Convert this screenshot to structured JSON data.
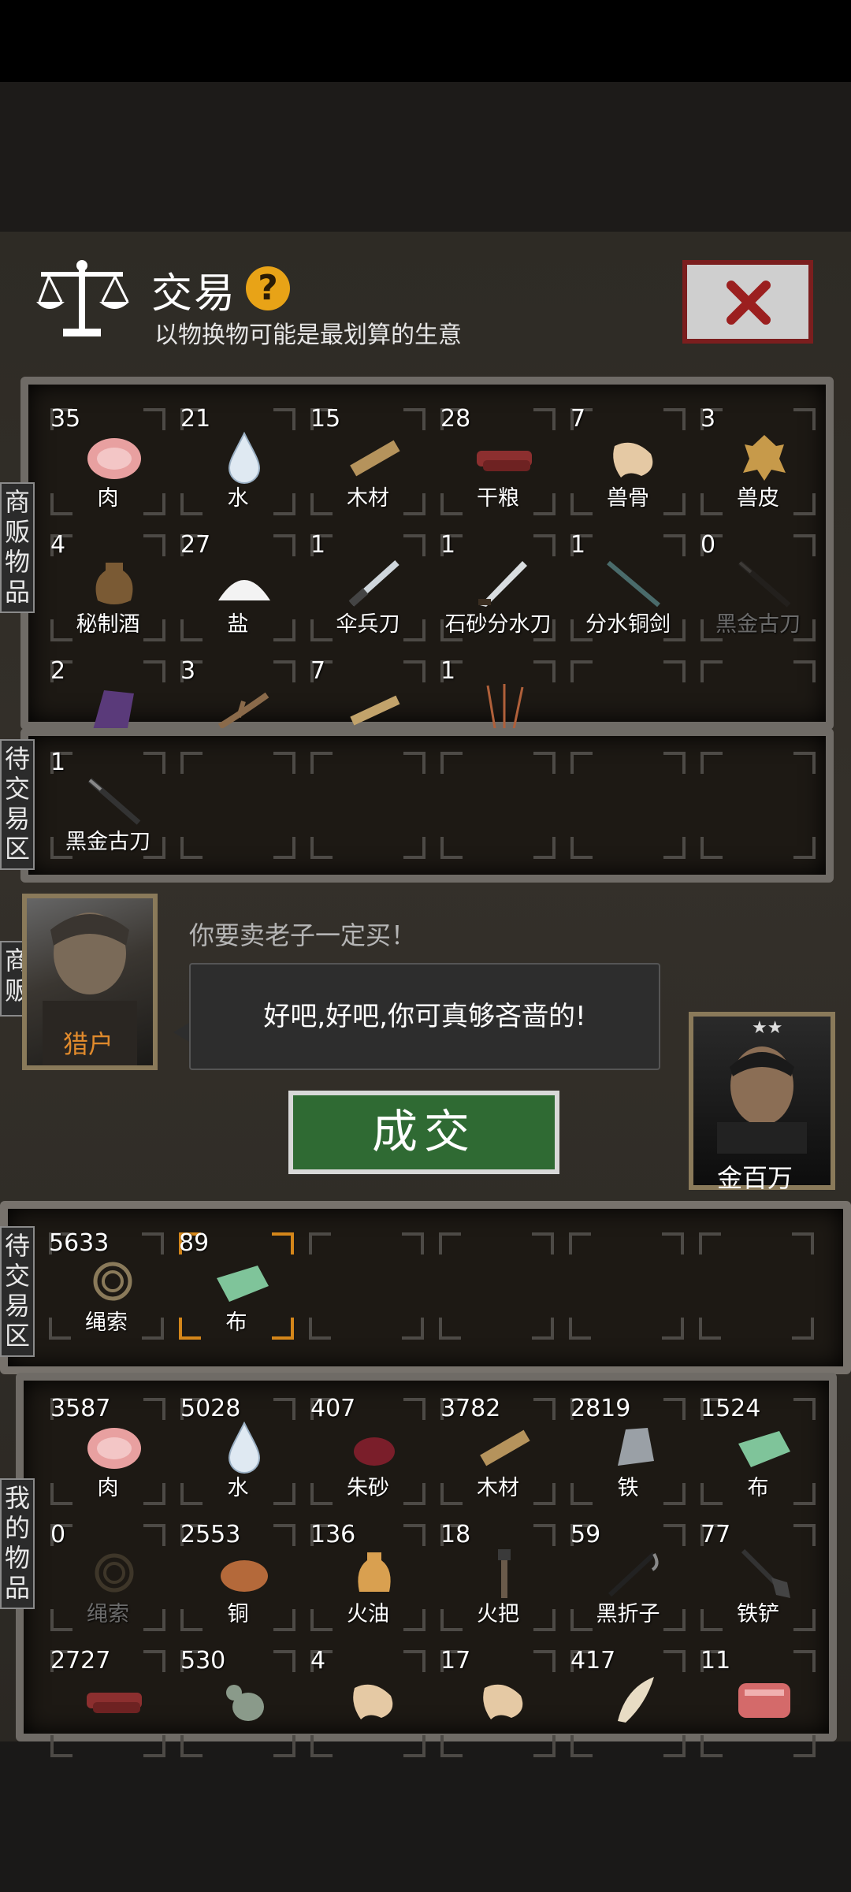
{
  "header": {
    "title": "交易",
    "help_label": "?",
    "subtitle": "以物换物可能是最划算的生意"
  },
  "tabs": {
    "merchant_goods": "商贩物品",
    "pending_merchant": "待交易区",
    "merchant": "商贩",
    "pending_mine": "待交易区",
    "my_goods": "我的物品"
  },
  "merchant_goods": [
    {
      "count": "35",
      "name": "肉",
      "icon": "meat-icon"
    },
    {
      "count": "21",
      "name": "水",
      "icon": "water-icon"
    },
    {
      "count": "15",
      "name": "木材",
      "icon": "wood-icon"
    },
    {
      "count": "28",
      "name": "干粮",
      "icon": "jerky-icon"
    },
    {
      "count": "7",
      "name": "兽骨",
      "icon": "bone-icon"
    },
    {
      "count": "3",
      "name": "兽皮",
      "icon": "hide-icon"
    },
    {
      "count": "4",
      "name": "秘制酒",
      "icon": "wine-jar-icon"
    },
    {
      "count": "27",
      "name": "盐",
      "icon": "salt-icon"
    },
    {
      "count": "1",
      "name": "伞兵刀",
      "icon": "knife-icon"
    },
    {
      "count": "1",
      "name": "石砂分水刀",
      "icon": "blade-icon"
    },
    {
      "count": "1",
      "name": "分水铜剑",
      "icon": "sword-icon"
    },
    {
      "count": "0",
      "name": "黑金古刀",
      "icon": "black-blade-icon"
    },
    {
      "count": "2",
      "name": "",
      "icon": "purple-stone-icon"
    },
    {
      "count": "3",
      "name": "",
      "icon": "branch-icon"
    },
    {
      "count": "7",
      "name": "",
      "icon": "plank-icon"
    },
    {
      "count": "1",
      "name": "",
      "icon": "sticks-icon"
    }
  ],
  "merchant_pending": [
    {
      "count": "1",
      "name": "黑金古刀",
      "icon": "black-blade-icon"
    }
  ],
  "merchant_npc": {
    "name": "猎户",
    "quote": "你要卖老子一定买！",
    "reply": "好吧,好吧,你可真够吝啬的!"
  },
  "deal_button": "成交",
  "player": {
    "name": "金百万",
    "stars": "★★"
  },
  "my_pending": [
    {
      "count": "5633",
      "name": "绳索",
      "icon": "rope-icon"
    },
    {
      "count": "89",
      "name": "布",
      "icon": "cloth-icon"
    }
  ],
  "my_goods": [
    {
      "count": "3587",
      "name": "肉",
      "icon": "meat-icon"
    },
    {
      "count": "5028",
      "name": "水",
      "icon": "water-icon"
    },
    {
      "count": "407",
      "name": "朱砂",
      "icon": "cinnabar-icon"
    },
    {
      "count": "3782",
      "name": "木材",
      "icon": "wood-icon"
    },
    {
      "count": "2819",
      "name": "铁",
      "icon": "iron-icon"
    },
    {
      "count": "1524",
      "name": "布",
      "icon": "cloth-icon"
    },
    {
      "count": "0",
      "name": "绳索",
      "icon": "rope-icon"
    },
    {
      "count": "2553",
      "name": "铜",
      "icon": "copper-icon"
    },
    {
      "count": "136",
      "name": "火油",
      "icon": "oil-icon"
    },
    {
      "count": "18",
      "name": "火把",
      "icon": "torch-icon"
    },
    {
      "count": "59",
      "name": "黑折子",
      "icon": "hook-icon"
    },
    {
      "count": "77",
      "name": "铁铲",
      "icon": "shovel-icon"
    },
    {
      "count": "2727",
      "name": "",
      "icon": "jerky-icon"
    },
    {
      "count": "530",
      "name": "",
      "icon": "gourd-icon"
    },
    {
      "count": "4",
      "name": "",
      "icon": "bone-icon"
    },
    {
      "count": "17",
      "name": "",
      "icon": "bone-icon"
    },
    {
      "count": "417",
      "name": "",
      "icon": "tooth-icon"
    },
    {
      "count": "11",
      "name": "",
      "icon": "raw-meat-icon"
    }
  ]
}
